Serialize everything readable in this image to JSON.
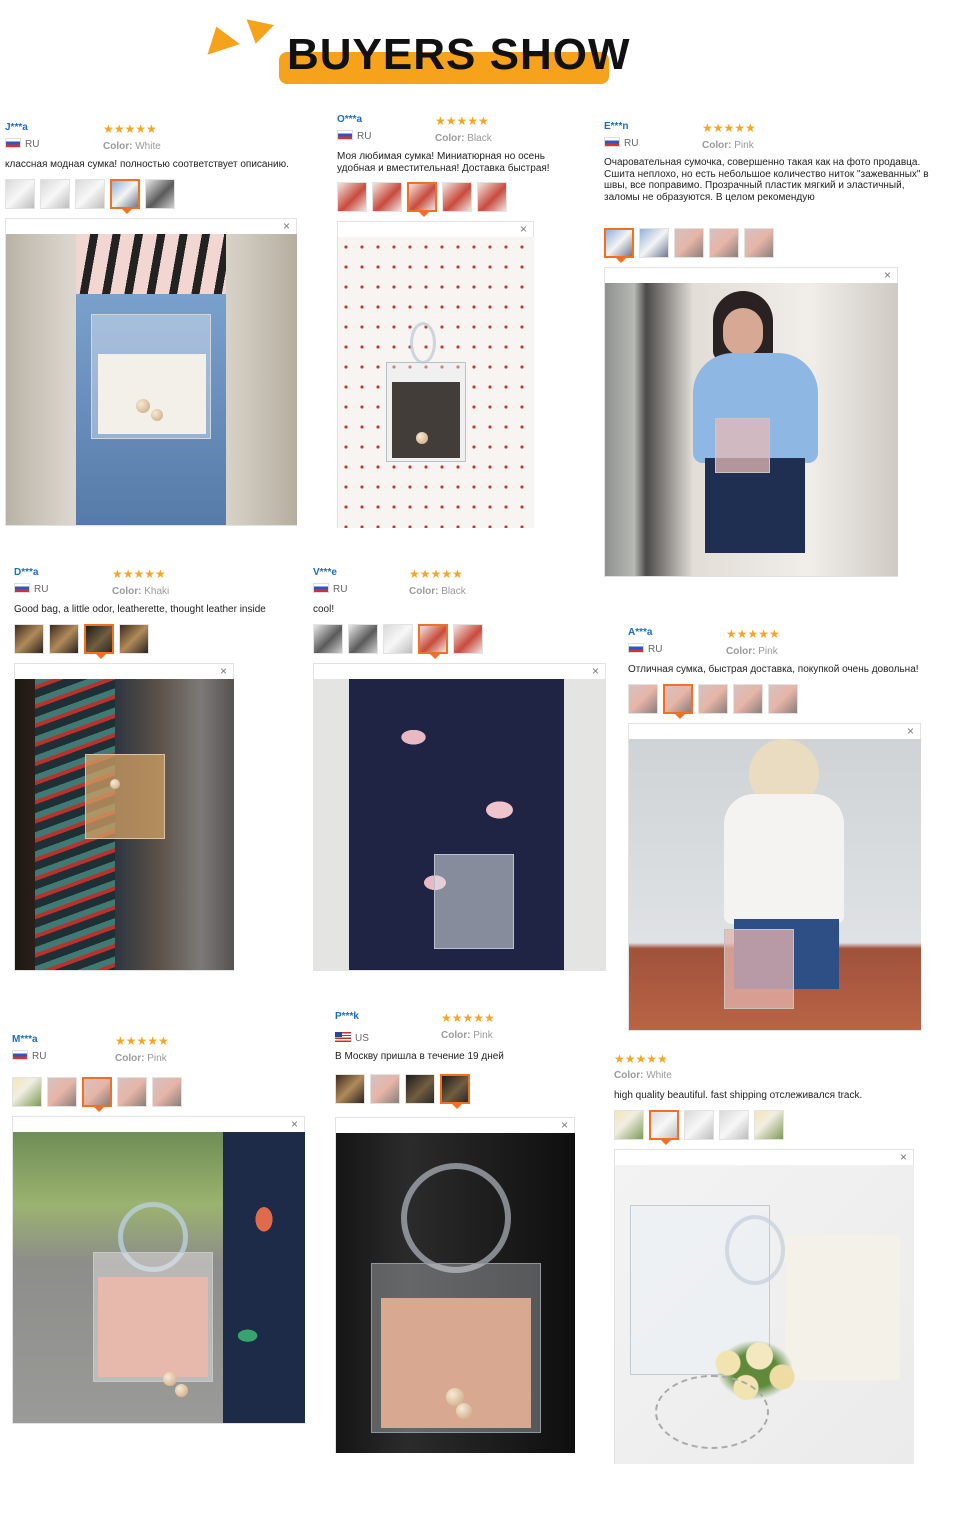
{
  "header": {
    "title": "BUYERS SHOW",
    "accent": "#f6a21a"
  },
  "reviews": [
    {
      "user": "J***a",
      "country": "RU",
      "stars": "★★★★★",
      "color_label": "Color:",
      "color": "White",
      "text": "классная модная сумка! полностью соответствует описанию.",
      "thumbs": [
        "white",
        "white",
        "white",
        "blue",
        "black"
      ]
    },
    {
      "user": "O***a",
      "country": "RU",
      "stars": "★★★★★",
      "color_label": "Color:",
      "color": "Black",
      "text": "Моя любимая сумка! Миниатюрная но осень удобная и вместительная! Доставка быстрая!",
      "thumbs": [
        "red",
        "red",
        "red",
        "red",
        "red"
      ]
    },
    {
      "user": "E***n",
      "country": "RU",
      "stars": "★★★★★",
      "color_label": "Color:",
      "color": "Pink",
      "text": "Очаровательная сумочка, совершенно такая как на фото продавца. Сшита неплохо, но есть небольшое количество ниток \"зажеванных\" в швы, все поправимо. Прозрачный пластик мягкий и эластичный, заломы не образуются. В целом рекомендую",
      "thumbs": [
        "blue",
        "blue",
        "pink",
        "pink",
        "pink"
      ]
    },
    {
      "user": "D***a",
      "country": "RU",
      "stars": "★★★★★",
      "color_label": "Color:",
      "color": "Khaki",
      "text": "Good bag, a little odor, leatherette, thought leather inside",
      "thumbs": [
        "khaki",
        "khaki",
        "dark",
        "khaki"
      ]
    },
    {
      "user": "V***e",
      "country": "RU",
      "stars": "★★★★★",
      "color_label": "Color:",
      "color": "Black",
      "text": "cool!",
      "thumbs": [
        "black",
        "black",
        "white",
        "red",
        "red"
      ]
    },
    {
      "user": "A***a",
      "country": "RU",
      "stars": "★★★★★",
      "color_label": "Color:",
      "color": "Pink",
      "text": "Отличная сумка, быстрая доставка, покупкой очень довольна!",
      "thumbs": [
        "pink",
        "pink",
        "pink",
        "pink",
        "pink"
      ]
    },
    {
      "user": "M***a",
      "country": "RU",
      "stars": "★★★★★",
      "color_label": "Color:",
      "color": "Pink",
      "text": "",
      "thumbs": [
        "flow",
        "pink",
        "pink",
        "pink",
        "pink"
      ]
    },
    {
      "user": "P***k",
      "country": "US",
      "stars": "★★★★★",
      "color_label": "Color:",
      "color": "Pink",
      "text": "В Москву пришла в течение 19 дней",
      "thumbs": [
        "khaki",
        "pink",
        "dark",
        "dark"
      ]
    },
    {
      "user": "",
      "country": "",
      "stars": "★★★★★",
      "color_label": "Color:",
      "color": "White",
      "text": "high quality beautiful. fast shipping отслеживался track.",
      "thumbs": [
        "flow",
        "white",
        "white",
        "white",
        "flow"
      ]
    }
  ],
  "viewer": {
    "close_glyph": "×"
  }
}
